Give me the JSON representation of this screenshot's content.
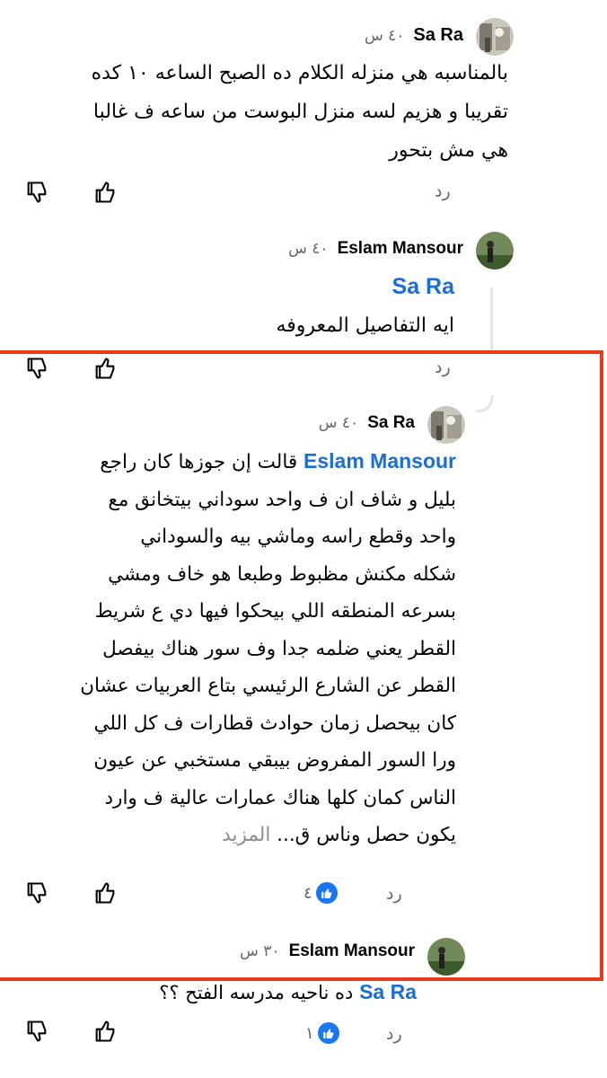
{
  "comments": [
    {
      "author": "Sa Ra",
      "time": "٤٠ س",
      "text_lines": [
        "بالمناسبه هي منزله الكلام ده الصبح الساعه ١٠ كده",
        "تقريبا و هزيم لسه منزل البوست من ساعه ف غالبا",
        "هي مش بتحور"
      ],
      "reply_label": "رد"
    },
    {
      "author": "Eslam Mansour",
      "time": "٤٠ س",
      "mention": "Sa Ra",
      "text_lines": [
        "ايه التفاصيل المعروفه"
      ],
      "reply_label": "رد"
    },
    {
      "author": "Sa Ra",
      "time": "٤٠ س",
      "mention": "Eslam Mansour",
      "first_line_rest": "قالت إن جوزها كان راجع",
      "text_lines": [
        "بليل و شاف ان ف واحد سوداني بيتخانق مع",
        "واحد وقطع راسه وماشي بيه والسوداني",
        "شكله مكنش مظبوط وطبعا هو خاف ومشي",
        "بسرعه المنطقه اللي بيحكوا فيها دي ع شريط",
        "القطر يعني ضلمه جدا وف سور هناك بيفصل",
        "القطر عن الشارع الرئيسي بتاع العربيات عشان",
        "كان بيحصل زمان حوادث قطارات ف كل اللي",
        "ورا السور المفروض بيبقي مستخبي عن عيون",
        "الناس كمان كلها هناك عمارات عالية ف وارد"
      ],
      "last_line": "يكون حصل وناس ق...",
      "see_more": "المزيد",
      "reply_label": "رد",
      "like_count": "٤"
    },
    {
      "author": "Eslam Mansour",
      "time": "٣٠ س",
      "mention": "Sa Ra",
      "text_partial": "ده ناحيه مدرسه الفتح ؟؟",
      "reply_label": "رد",
      "like_count": "١"
    }
  ],
  "icons": {
    "like": "thumbs-up-icon",
    "dislike": "thumbs-down-icon",
    "reaction": "like-reaction-icon"
  },
  "colors": {
    "mention": "#1a6ed8",
    "highlight_box": "#ea3a1e",
    "like_bubble": "#1877f2",
    "secondary_text": "#65676b"
  }
}
